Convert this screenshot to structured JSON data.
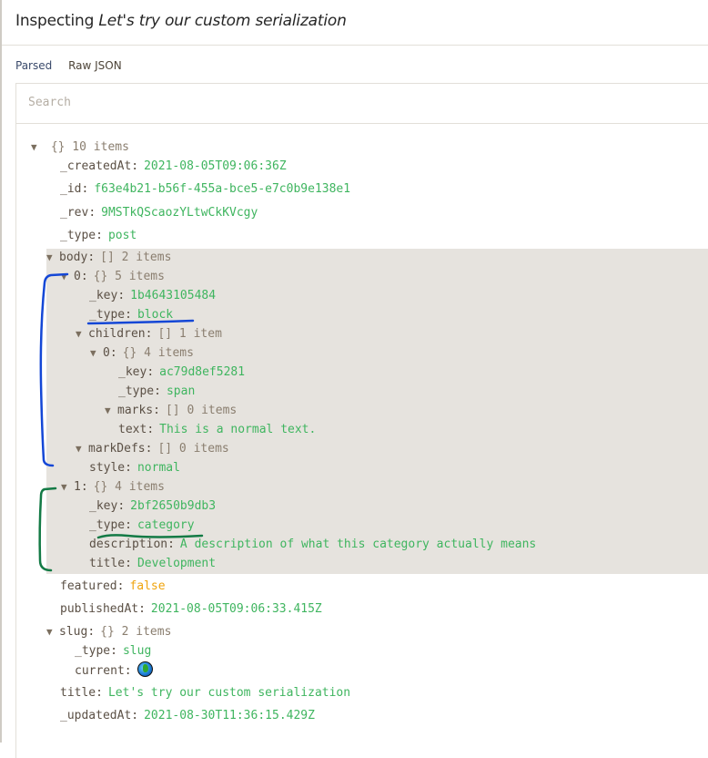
{
  "header": {
    "prefix": "Inspecting",
    "document_title": "Let's try our custom serialization"
  },
  "tabs": [
    {
      "label": "Parsed",
      "active": true
    },
    {
      "label": "Raw JSON",
      "active": false
    }
  ],
  "search": {
    "placeholder": "Search",
    "value": ""
  },
  "tree": {
    "root_meta": "{} 10 items",
    "createdAt": {
      "key": "_createdAt",
      "value": "2021-08-05T09:06:36Z"
    },
    "id": {
      "key": "_id",
      "value": "f63e4b21-b56f-455a-bce5-e7c0b9e138e1"
    },
    "rev": {
      "key": "_rev",
      "value": "9MSTkQScaozYLtwCkKVcgy"
    },
    "type": {
      "key": "_type",
      "value": "post"
    },
    "body": {
      "key": "body",
      "meta": "[] 2 items",
      "item0": {
        "key": "0",
        "meta": "{} 5 items",
        "_key": {
          "key": "_key",
          "value": "1b4643105484"
        },
        "_type": {
          "key": "_type",
          "value": "block"
        },
        "children": {
          "key": "children",
          "meta": "[] 1 item",
          "item0": {
            "key": "0",
            "meta": "{} 4 items",
            "_key": {
              "key": "_key",
              "value": "ac79d8ef5281"
            },
            "_type": {
              "key": "_type",
              "value": "span"
            },
            "marks": {
              "key": "marks",
              "meta": "[] 0 items"
            },
            "text": {
              "key": "text",
              "value": "This is a normal text."
            }
          }
        },
        "markDefs": {
          "key": "markDefs",
          "meta": "[] 0 items"
        },
        "style": {
          "key": "style",
          "value": "normal"
        }
      },
      "item1": {
        "key": "1",
        "meta": "{} 4 items",
        "_key": {
          "key": "_key",
          "value": "2bf2650b9db3"
        },
        "_type": {
          "key": "_type",
          "value": "category"
        },
        "description": {
          "key": "description",
          "value": "A description of what this category actually means"
        },
        "title": {
          "key": "title",
          "value": "Development"
        }
      }
    },
    "featured": {
      "key": "featured",
      "value": "false"
    },
    "publishedAt": {
      "key": "publishedAt",
      "value": "2021-08-05T09:06:33.415Z"
    },
    "slug": {
      "key": "slug",
      "meta": "{} 2 items",
      "_type": {
        "key": "_type",
        "value": "slug"
      },
      "current": {
        "key": "current",
        "icon": "globe-icon"
      }
    },
    "title": {
      "key": "title",
      "value": "Let's try our custom serialization"
    },
    "updatedAt": {
      "key": "_updatedAt",
      "value": "2021-08-30T11:36:15.429Z"
    }
  },
  "colors": {
    "string": "#3fb55f",
    "boolean": "#f0a40e",
    "key": "#5b5045",
    "highlight_bg": "#e6e3de",
    "annotation_blue": "#1447d6",
    "annotation_green": "#137a45",
    "active_tab": "#3a4a6b"
  }
}
